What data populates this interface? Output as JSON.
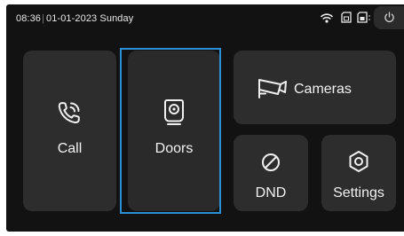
{
  "status_bar": {
    "time": "08:36",
    "date": "01-01-2023 Sunday",
    "icons": [
      "wifi-icon",
      "sd-card-icon",
      "sim-card-icon",
      "power-icon"
    ]
  },
  "tiles": {
    "call": {
      "label": "Call",
      "icon": "phone-icon"
    },
    "doors": {
      "label": "Doors",
      "icon": "door-station-icon"
    },
    "cameras": {
      "label": "Cameras",
      "icon": "camera-icon"
    },
    "dnd": {
      "label": "DND",
      "icon": "do-not-disturb-icon"
    },
    "settings": {
      "label": "Settings",
      "icon": "settings-icon"
    }
  },
  "focused_tile": "doors",
  "colors": {
    "background": "#121212",
    "tile": "#2d2d2d",
    "focus": "#2a8fd6",
    "text": "#f2f2f2"
  }
}
